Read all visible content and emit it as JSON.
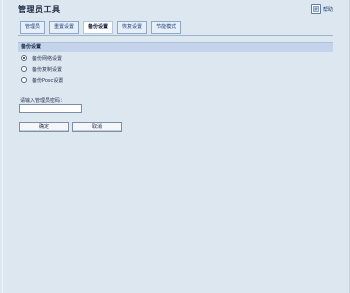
{
  "header": {
    "title": "管理员工具",
    "help_label": "帮助"
  },
  "tabs": [
    {
      "label": "管理员",
      "active": false
    },
    {
      "label": "重置设置",
      "active": false
    },
    {
      "label": "备份设置",
      "active": true
    },
    {
      "label": "恢复设置",
      "active": false
    },
    {
      "label": "节能模式",
      "active": false
    }
  ],
  "section": {
    "title": "备份设置",
    "options": [
      {
        "label": "备份网络设置",
        "checked": true
      },
      {
        "label": "备份复制设置",
        "checked": false
      },
      {
        "label": "备份Posc设置",
        "checked": false
      }
    ]
  },
  "password": {
    "label": "请输入管理员密码：",
    "value": ""
  },
  "buttons": {
    "ok_label": "确定",
    "cancel_label": "取消"
  },
  "colors": {
    "background": "#dce7f0",
    "section_header": "#c3d4ea",
    "tab_border": "#8fa8c8",
    "accent_text": "#1e3f7a"
  }
}
